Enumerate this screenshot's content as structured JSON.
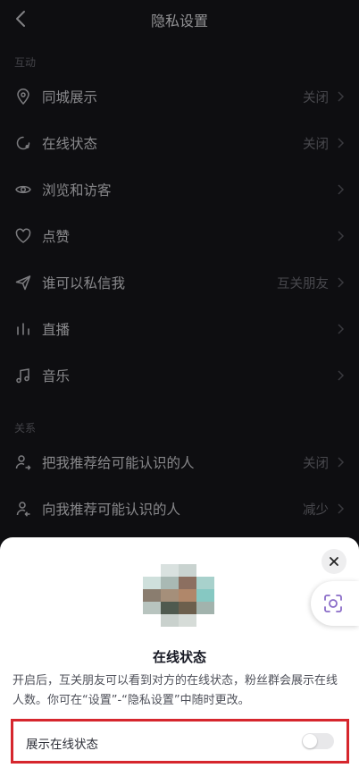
{
  "header": {
    "title": "隐私设置"
  },
  "sections": {
    "interaction": "互动",
    "relations": "关系"
  },
  "rows": {
    "city": {
      "label": "同城展示",
      "value": "关闭"
    },
    "online": {
      "label": "在线状态",
      "value": "关闭"
    },
    "visits": {
      "label": "浏览和访客",
      "value": ""
    },
    "likes": {
      "label": "点赞",
      "value": ""
    },
    "dm": {
      "label": "谁可以私信我",
      "value": "互关朋友"
    },
    "live": {
      "label": "直播",
      "value": ""
    },
    "music": {
      "label": "音乐",
      "value": ""
    },
    "recommend_me": {
      "label": "把我推荐给可能认识的人",
      "value": "关闭"
    },
    "recommend_to_me": {
      "label": "向我推荐可能认识的人",
      "value": "减少"
    }
  },
  "sheet": {
    "title": "在线状态",
    "description": "开启后，互关朋友可以看到对方的在线状态，粉丝群会展示在线人数。你可在“设置”-“隐私设置”中随时更改。",
    "toggle_label": "展示在线状态",
    "toggle_on": false
  },
  "colors": {
    "background": "#17171c",
    "sheet": "#ffffff",
    "highlight_border": "#d6262d"
  }
}
